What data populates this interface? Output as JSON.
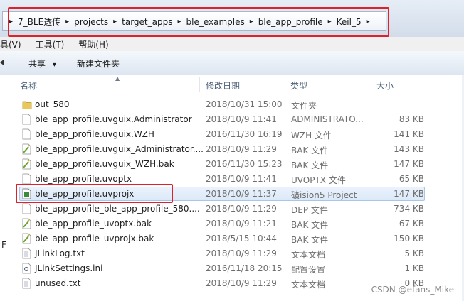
{
  "breadcrumb": {
    "items": [
      "7_BLE透传",
      "projects",
      "target_apps",
      "ble_examples",
      "ble_app_profile",
      "Keil_5"
    ],
    "separator": "▸"
  },
  "menu": {
    "items": [
      "具(V)",
      "工具(T)",
      "帮助(H)"
    ]
  },
  "toolbar": {
    "share_label": "共享",
    "share_arrow": "▾",
    "new_folder_label": "新建文件夹"
  },
  "columns": {
    "name": "名称",
    "date": "修改日期",
    "type": "类型",
    "size": "大小"
  },
  "files": [
    {
      "name": "out_580",
      "date": "2018/10/31 15:00",
      "type": "文件夹",
      "size": "",
      "icon": "folder-icon"
    },
    {
      "name": "ble_app_profile.uvguix.Administrator",
      "date": "2018/10/9 11:41",
      "type": "ADMINISTRATO...",
      "size": "83 KB",
      "icon": "file-icon"
    },
    {
      "name": "ble_app_profile.uvguix.WZH",
      "date": "2016/11/30 16:19",
      "type": "WZH 文件",
      "size": "141 KB",
      "icon": "file-icon"
    },
    {
      "name": "ble_app_profile.uvguix_Administrator....",
      "date": "2018/10/9 11:29",
      "type": "BAK 文件",
      "size": "143 KB",
      "icon": "bak-file-icon"
    },
    {
      "name": "ble_app_profile.uvguix_WZH.bak",
      "date": "2016/11/30 15:23",
      "type": "BAK 文件",
      "size": "147 KB",
      "icon": "bak-file-icon"
    },
    {
      "name": "ble_app_profile.uvoptx",
      "date": "2018/10/9 11:41",
      "type": "UVOPTX 文件",
      "size": "65 KB",
      "icon": "file-icon"
    },
    {
      "name": "ble_app_profile.uvprojx",
      "date": "2018/10/9 11:37",
      "type": "礦ision5 Project",
      "size": "147 KB",
      "icon": "keil-project-icon",
      "selected": true
    },
    {
      "name": "ble_app_profile_ble_app_profile_580....",
      "date": "2018/10/9 11:29",
      "type": "DEP 文件",
      "size": "734 KB",
      "icon": "file-icon"
    },
    {
      "name": "ble_app_profile_uvoptx.bak",
      "date": "2018/10/9 11:21",
      "type": "BAK 文件",
      "size": "67 KB",
      "icon": "bak-file-icon"
    },
    {
      "name": "ble_app_profile_uvprojx.bak",
      "date": "2018/5/15 10:44",
      "type": "BAK 文件",
      "size": "150 KB",
      "icon": "bak-file-icon"
    },
    {
      "name": "JLinkLog.txt",
      "date": "2018/10/9 11:29",
      "type": "文本文档",
      "size": "5 KB",
      "icon": "text-file-icon"
    },
    {
      "name": "JLinkSettings.ini",
      "date": "2016/11/18 20:15",
      "type": "配置设置",
      "size": "1 KB",
      "icon": "ini-file-icon"
    },
    {
      "name": "unused.txt",
      "date": "2018/10/9 11:29",
      "type": "文本文档",
      "size": "0 KB",
      "icon": "text-file-icon"
    }
  ],
  "side_letter": "F",
  "watermark": "CSDN @efans_Mike",
  "colors": {
    "highlight_red": "#e0212b",
    "selection_blue": "#dce9f8",
    "header_text": "#4c607a"
  }
}
